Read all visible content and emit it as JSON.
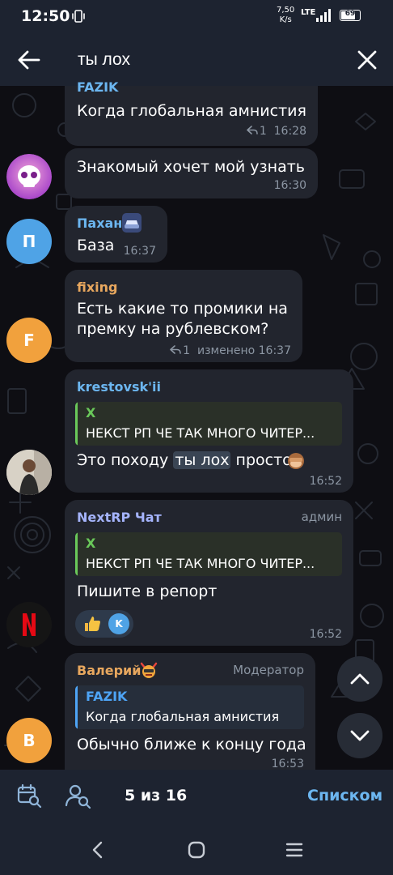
{
  "status_bar": {
    "time": "12:50",
    "speed_value": "7,50",
    "speed_unit": "K/s",
    "network": "LTE",
    "battery": "69",
    "battery_level": 0.69
  },
  "header": {
    "search_value": "ты лох",
    "back_icon": "arrow-left-icon",
    "close_icon": "close-icon"
  },
  "messages": [
    {
      "author": "FAZIK",
      "text": "Когда глобальная амнистия",
      "replies": "1",
      "time": "16:28"
    },
    {
      "text": "Знакомый хочет мой узнать",
      "time": "16:30"
    },
    {
      "author": "Пахан",
      "avatar_letter": "П",
      "text": "База",
      "time": "16:37"
    },
    {
      "author": "fixing",
      "avatar_letter": "F",
      "text_line1": "Есть какие то промики на",
      "text_line2": "премку на рублевском?",
      "replies": "1",
      "edited": "изменено",
      "time": "16:37"
    },
    {
      "author": "krestovsk'ii",
      "quote_author": "X",
      "quote_text": "НЕКСТ РП ЧЕ ТАК МНОГО ЧИТЕР...",
      "text_before": "Это походу",
      "text_highlight": "ты лох",
      "text_after": "просто",
      "emoji": "monkey-icon",
      "time": "16:52"
    },
    {
      "author": "NextRP Чат",
      "role": "админ",
      "quote_author": "X",
      "quote_text": "НЕКСТ РП ЧЕ ТАК МНОГО ЧИТЕР...",
      "text": "Пишите в репорт",
      "reaction": "thumbs-up-icon",
      "reaction_avatar": "K",
      "time": "16:52"
    },
    {
      "author": "Валерий",
      "role": "Модератор",
      "avatar_letter": "В",
      "quote_author": "FAZIK",
      "quote_text": "Когда глобальная амнистия",
      "text": "Обычно ближе к концу года",
      "time": "16:53"
    }
  ],
  "bottom_bar": {
    "result_counter": "5 из 16",
    "list_button": "Списком",
    "calendar_icon": "calendar-search-icon",
    "user_icon": "user-search-icon"
  },
  "colors": {
    "bubble": "#22252e",
    "name_blue": "#6cb6f0",
    "name_orange": "#e8a75e",
    "name_purple": "#a5b4fc",
    "quote_green": "#6ac85a",
    "quote_blue": "#4ea4f5"
  }
}
